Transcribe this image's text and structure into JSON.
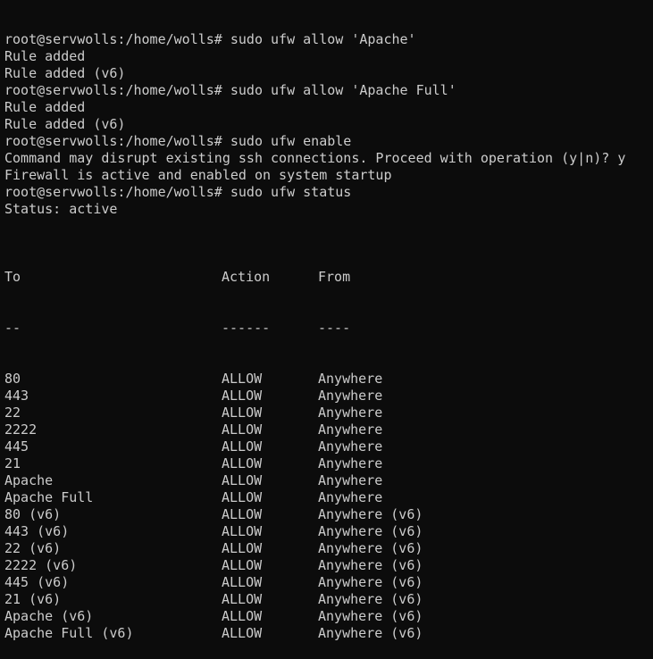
{
  "prompt": "root@servwolls:/home/wolls#",
  "lines": [
    {
      "kind": "cmd",
      "text": "sudo ufw allow 'Apache'"
    },
    {
      "kind": "out",
      "text": "Rule added"
    },
    {
      "kind": "out",
      "text": "Rule added (v6)"
    },
    {
      "kind": "cmd",
      "text": "sudo ufw allow 'Apache Full'"
    },
    {
      "kind": "out",
      "text": "Rule added"
    },
    {
      "kind": "out",
      "text": "Rule added (v6)"
    },
    {
      "kind": "cmd",
      "text": "sudo ufw enable"
    },
    {
      "kind": "out",
      "text": "Command may disrupt existing ssh connections. Proceed with operation (y|n)? y"
    },
    {
      "kind": "out",
      "text": "Firewall is active and enabled on system startup"
    },
    {
      "kind": "cmd",
      "text": "sudo ufw status"
    },
    {
      "kind": "out",
      "text": "Status: active"
    },
    {
      "kind": "out",
      "text": ""
    }
  ],
  "table": {
    "headers": [
      "To",
      "Action",
      "From"
    ],
    "separators": [
      "--",
      "------",
      "----"
    ],
    "rows": [
      [
        "80",
        "ALLOW",
        "Anywhere"
      ],
      [
        "443",
        "ALLOW",
        "Anywhere"
      ],
      [
        "22",
        "ALLOW",
        "Anywhere"
      ],
      [
        "2222",
        "ALLOW",
        "Anywhere"
      ],
      [
        "445",
        "ALLOW",
        "Anywhere"
      ],
      [
        "21",
        "ALLOW",
        "Anywhere"
      ],
      [
        "Apache",
        "ALLOW",
        "Anywhere"
      ],
      [
        "Apache Full",
        "ALLOW",
        "Anywhere"
      ],
      [
        "80 (v6)",
        "ALLOW",
        "Anywhere (v6)"
      ],
      [
        "443 (v6)",
        "ALLOW",
        "Anywhere (v6)"
      ],
      [
        "22 (v6)",
        "ALLOW",
        "Anywhere (v6)"
      ],
      [
        "2222 (v6)",
        "ALLOW",
        "Anywhere (v6)"
      ],
      [
        "445 (v6)",
        "ALLOW",
        "Anywhere (v6)"
      ],
      [
        "21 (v6)",
        "ALLOW",
        "Anywhere (v6)"
      ],
      [
        "Apache (v6)",
        "ALLOW",
        "Anywhere (v6)"
      ],
      [
        "Apache Full (v6)",
        "ALLOW",
        "Anywhere (v6)"
      ]
    ]
  },
  "colors": {
    "background": "#0c0c0c",
    "foreground": "#cccccc"
  }
}
